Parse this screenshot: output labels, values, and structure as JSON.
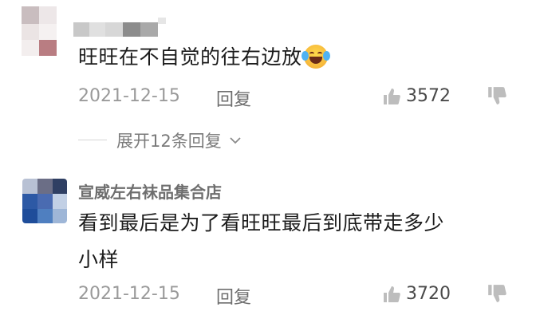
{
  "comments": [
    {
      "username": "",
      "text": "旺旺在不自觉的往右边放",
      "emoji": "laughing-crying-emoji",
      "date": "2021-12-15",
      "reply_label": "回复",
      "likes": "3572"
    },
    {
      "username": "宣威左右袜品集合店",
      "text_line1": "看到最后是为了看旺旺最后到底带走多少",
      "text_line2": "小样",
      "date": "2021-12-15",
      "reply_label": "回复",
      "likes": "3720"
    }
  ],
  "expand_replies": "展开12条回复",
  "colors": {
    "text": "#1b1b1b",
    "meta": "#9a9a9a",
    "icon": "#bdbdbd"
  }
}
